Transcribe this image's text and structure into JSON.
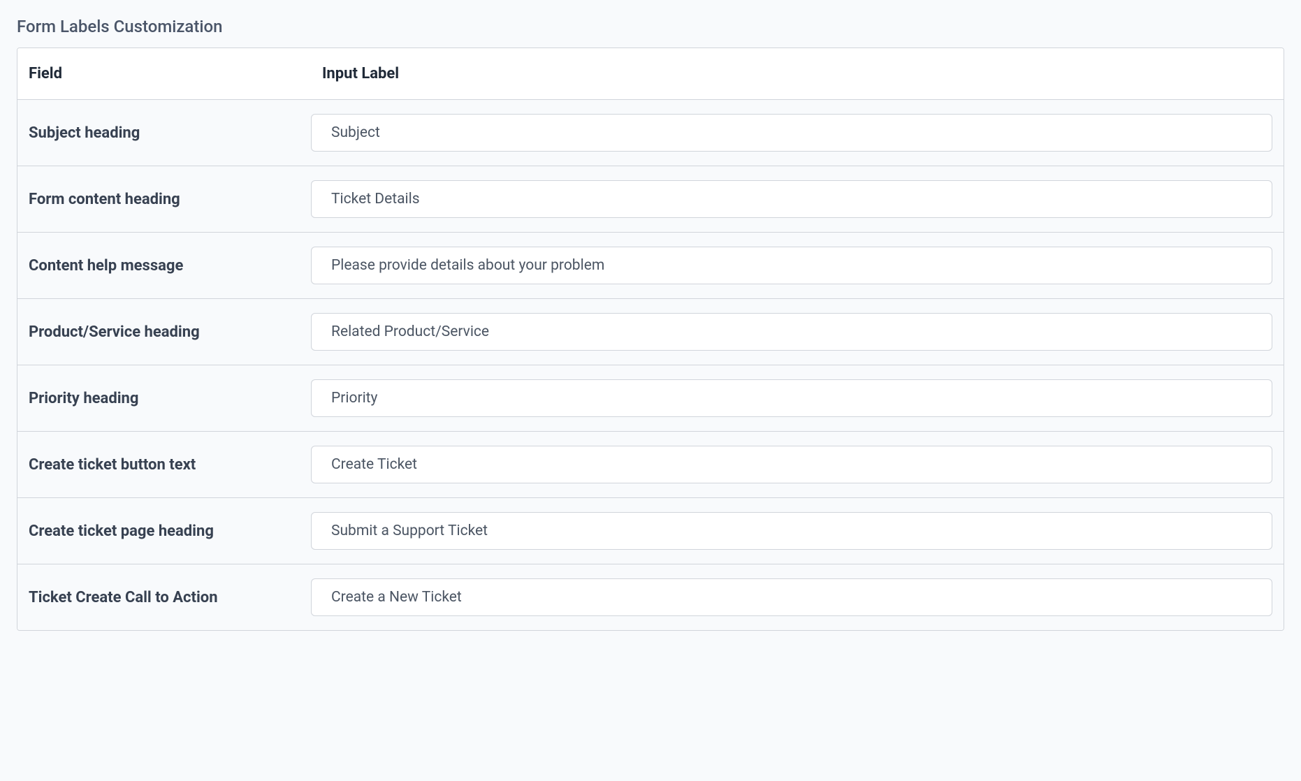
{
  "page": {
    "title": "Form Labels Customization"
  },
  "table": {
    "headers": {
      "field": "Field",
      "input_label": "Input Label"
    },
    "rows": [
      {
        "field": "Subject heading",
        "value": "Subject"
      },
      {
        "field": "Form content heading",
        "value": "Ticket Details"
      },
      {
        "field": "Content help message",
        "value": "Please provide details about your problem"
      },
      {
        "field": "Product/Service heading",
        "value": "Related Product/Service"
      },
      {
        "field": "Priority heading",
        "value": "Priority"
      },
      {
        "field": "Create ticket button text",
        "value": "Create Ticket"
      },
      {
        "field": "Create ticket page heading",
        "value": "Submit a Support Ticket"
      },
      {
        "field": "Ticket Create Call to Action",
        "value": "Create a New Ticket"
      }
    ]
  }
}
